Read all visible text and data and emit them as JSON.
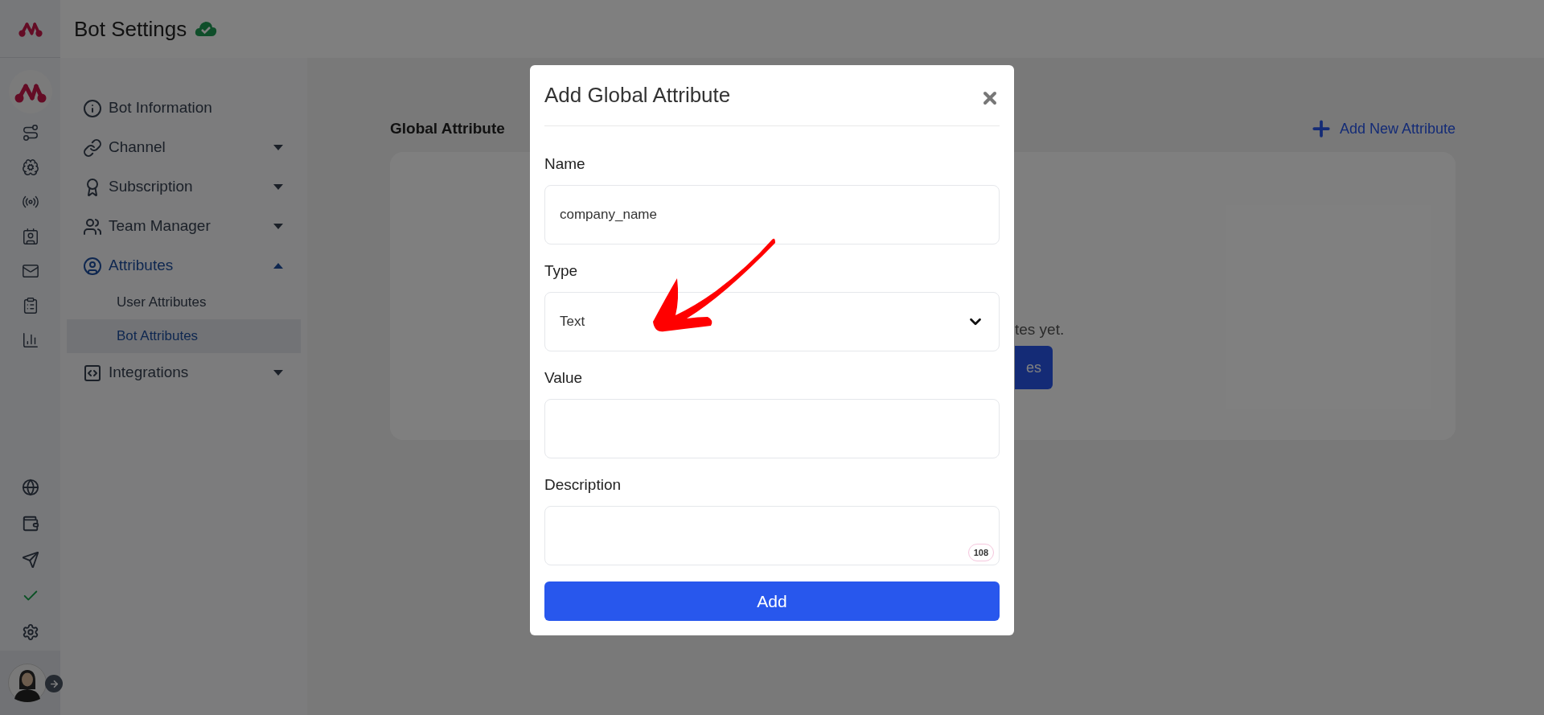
{
  "header": {
    "title": "Bot Settings"
  },
  "sidebar": {
    "items": [
      {
        "label": "Bot Information",
        "kind": "link",
        "selected": false
      },
      {
        "label": "Channel",
        "kind": "group",
        "selected": false,
        "expanded": false
      },
      {
        "label": "Subscription",
        "kind": "group",
        "selected": false,
        "expanded": false
      },
      {
        "label": "Team Manager",
        "kind": "group",
        "selected": false,
        "expanded": false
      },
      {
        "label": "Attributes",
        "kind": "group",
        "selected": true,
        "expanded": true,
        "children": [
          {
            "label": "User Attributes",
            "selected": false
          },
          {
            "label": "Bot Attributes",
            "selected": true
          }
        ]
      },
      {
        "label": "Integrations",
        "kind": "group",
        "selected": false,
        "expanded": false
      }
    ]
  },
  "main": {
    "title": "Global Attribute",
    "add_button": "Add New Attribute",
    "empty_text": "tes yet.",
    "empty_button": "es"
  },
  "modal": {
    "title": "Add Global Attribute",
    "fields": [
      {
        "label": "Name",
        "kind": "input",
        "value": "company_name"
      },
      {
        "label": "Type",
        "kind": "select",
        "value": "Text"
      },
      {
        "label": "Value",
        "kind": "input"
      },
      {
        "label": "Description",
        "kind": "textarea",
        "counter": "108"
      }
    ],
    "submit": "Add"
  }
}
